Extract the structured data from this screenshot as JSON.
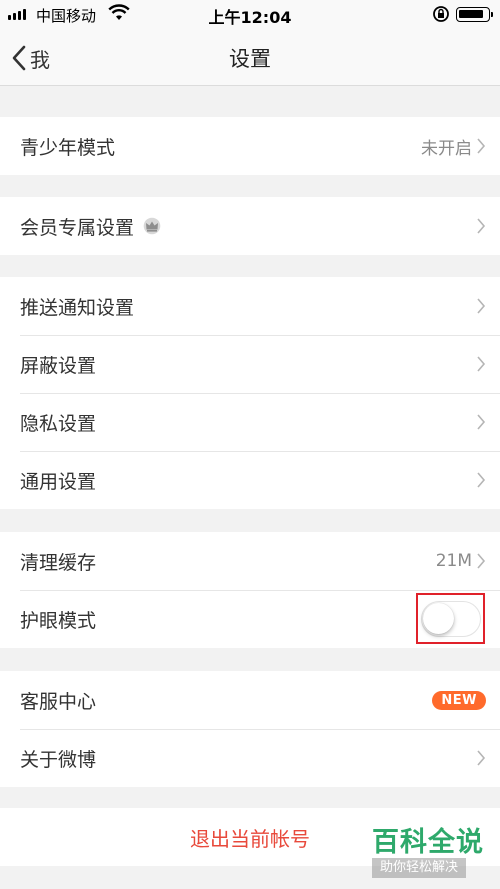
{
  "status_bar": {
    "carrier": "中国移动",
    "time": "上午12:04"
  },
  "nav": {
    "back_label": "我",
    "title": "设置"
  },
  "sections": {
    "teen": {
      "label": "青少年模式",
      "value": "未开启"
    },
    "vip": {
      "label": "会员专属设置",
      "icon": "crown-icon"
    },
    "general": [
      {
        "label": "推送通知设置"
      },
      {
        "label": "屏蔽设置"
      },
      {
        "label": "隐私设置"
      },
      {
        "label": "通用设置"
      }
    ],
    "storage": {
      "cache": {
        "label": "清理缓存",
        "value": "21M"
      },
      "eye_mode": {
        "label": "护眼模式",
        "enabled": false
      }
    },
    "support": {
      "service": {
        "label": "客服中心",
        "badge": "NEW"
      },
      "about": {
        "label": "关于微博"
      }
    }
  },
  "logout_label": "退出当前帐号",
  "watermark": {
    "title": "百科全说",
    "subtitle": "助你轻松解决"
  },
  "colors": {
    "background": "#f2f2f2",
    "logout_text": "#e8493b",
    "badge": "#ff6a2b",
    "highlight_frame": "#e0212a",
    "watermark": "#2ea96b"
  }
}
